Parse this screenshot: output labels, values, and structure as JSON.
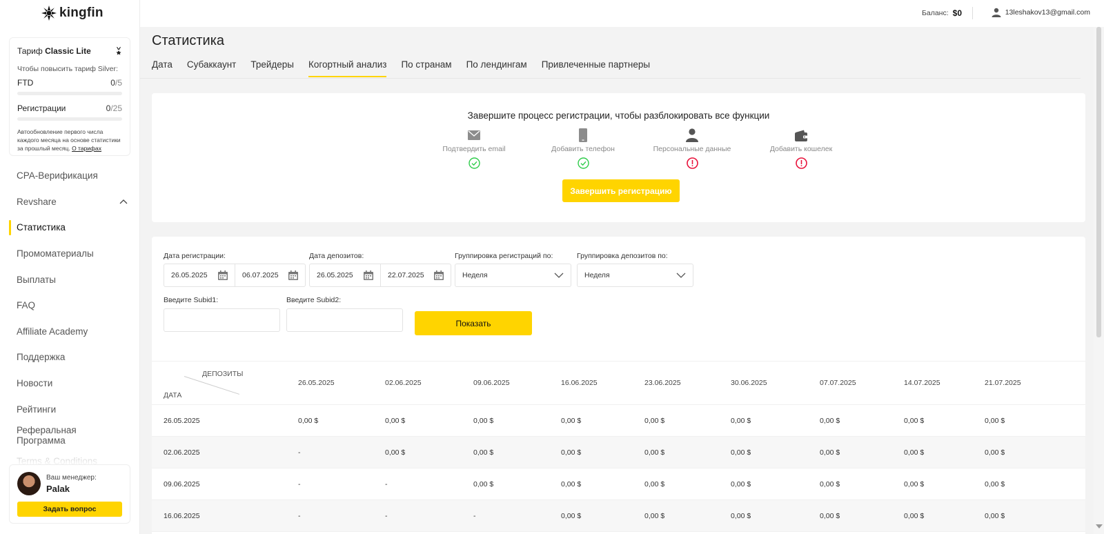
{
  "brand": {
    "name": "kingfin",
    "accent": "#ffd400",
    "error": "#e8113a",
    "success": "#2ecc4a"
  },
  "tariff": {
    "prefix": "Тариф",
    "name": "Classic Lite",
    "upgrade_text": "Чтобы повысить тариф Silver:",
    "ftd": {
      "label": "FTD",
      "value": "0",
      "max": "/5",
      "progress": 0
    },
    "registrations": {
      "label": "Регистрации",
      "value": "0",
      "max": "/25",
      "progress": 0
    },
    "note": "Автообновление первого числа каждого месяца на основе статистики за прошлый месяц.",
    "note_link": "О тарифах"
  },
  "nav": [
    {
      "label": "CPA-Верификация"
    },
    {
      "label": "Revshare",
      "expanded": true
    },
    {
      "label": "Статистика",
      "active": true
    },
    {
      "label": "Промоматериалы"
    },
    {
      "label": "Выплаты"
    },
    {
      "label": "FAQ"
    },
    {
      "label": "Affiliate Academy"
    },
    {
      "label": "Поддержка"
    },
    {
      "label": "Новости"
    },
    {
      "label": "Рейтинги"
    },
    {
      "label": "Реферальная Программа"
    },
    {
      "label": "Terms & Conditions"
    }
  ],
  "manager": {
    "label": "Ваш менеджер:",
    "name": "Palak",
    "button": "Задать вопрос"
  },
  "topbar": {
    "balance_label": "Баланс:",
    "balance_value": "$0",
    "user_email": "13leshakov13@gmail.com"
  },
  "page": {
    "title": "Статистика",
    "tabs": [
      "Дата",
      "Субаккаунт",
      "Трейдеры",
      "Когортный анализ",
      "По странам",
      "По лендингам",
      "Привлеченные партнеры"
    ],
    "active_tab": "Когортный анализ"
  },
  "registration": {
    "title": "Завершите процесс регистрации, чтобы разблокировать все функции",
    "steps": [
      {
        "label": "Подтвердить email",
        "icon": "envelope-icon",
        "status": "done"
      },
      {
        "label": "Добавить телефон",
        "icon": "phone-icon",
        "status": "done"
      },
      {
        "label": "Персональные данные",
        "icon": "person-icon",
        "status": "pending"
      },
      {
        "label": "Добавить кошелек",
        "icon": "wallet-icon",
        "status": "pending"
      }
    ],
    "button": "Завершить регистрацию"
  },
  "filters": {
    "reg_date_label": "Дата регистрации:",
    "reg_date_from": "26.05.2025",
    "reg_date_to": "06.07.2025",
    "dep_date_label": "Дата депозитов:",
    "dep_date_from": "26.05.2025",
    "dep_date_to": "22.07.2025",
    "reg_group_label": "Группировка регистраций по:",
    "reg_group_value": "Неделя",
    "dep_group_label": "Группировка депозитов по:",
    "dep_group_value": "Неделя",
    "subid1_label": "Введите Subid1:",
    "subid1_value": "",
    "subid2_label": "Введите Subid2:",
    "subid2_value": "",
    "show_button": "Показать"
  },
  "cohort": {
    "corner_top": "ДЕПОЗИТЫ",
    "corner_bottom": "ДАТА",
    "columns": [
      "26.05.2025",
      "02.06.2025",
      "09.06.2025",
      "16.06.2025",
      "23.06.2025",
      "30.06.2025",
      "07.07.2025",
      "14.07.2025",
      "21.07.2025"
    ],
    "rows": [
      {
        "date": "26.05.2025",
        "values": [
          "0,00 $",
          "0,00 $",
          "0,00 $",
          "0,00 $",
          "0,00 $",
          "0,00 $",
          "0,00 $",
          "0,00 $",
          "0,00 $"
        ]
      },
      {
        "date": "02.06.2025",
        "values": [
          "-",
          "0,00 $",
          "0,00 $",
          "0,00 $",
          "0,00 $",
          "0,00 $",
          "0,00 $",
          "0,00 $",
          "0,00 $"
        ]
      },
      {
        "date": "09.06.2025",
        "values": [
          "-",
          "-",
          "0,00 $",
          "0,00 $",
          "0,00 $",
          "0,00 $",
          "0,00 $",
          "0,00 $",
          "0,00 $"
        ]
      },
      {
        "date": "16.06.2025",
        "values": [
          "-",
          "-",
          "-",
          "0,00 $",
          "0,00 $",
          "0,00 $",
          "0,00 $",
          "0,00 $",
          "0,00 $"
        ]
      }
    ]
  }
}
